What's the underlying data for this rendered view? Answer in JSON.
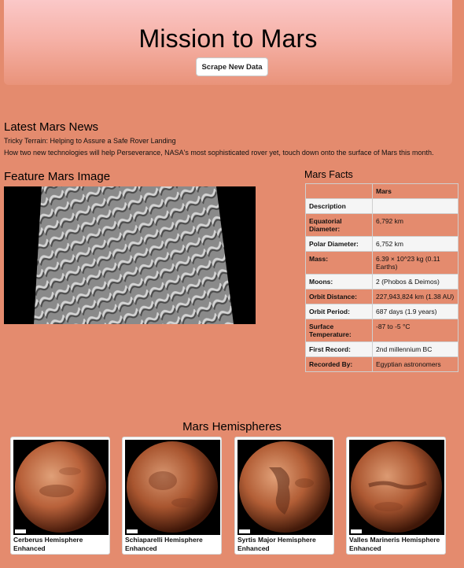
{
  "header": {
    "title": "Mission to Mars",
    "scrape_button_label": "Scrape New Data"
  },
  "news": {
    "section_title": "Latest Mars News",
    "headline": "Tricky Terrain: Helping to Assure a Safe Rover Landing",
    "teaser": "How two new technologies will help Perseverance, NASA's most sophisticated rover yet, touch down onto the surface of Mars this month."
  },
  "feature": {
    "section_title": "Feature Mars Image"
  },
  "facts": {
    "section_title": "Mars Facts",
    "header": "Mars",
    "rows": [
      {
        "label": "Description",
        "value": ""
      },
      {
        "label": "Equatorial Diameter:",
        "value": "6,792 km"
      },
      {
        "label": "Polar Diameter:",
        "value": "6,752 km"
      },
      {
        "label": "Mass:",
        "value": "6.39 × 10^23 kg (0.11 Earths)"
      },
      {
        "label": "Moons:",
        "value": "2 (Phobos & Deimos)"
      },
      {
        "label": "Orbit Distance:",
        "value": "227,943,824 km (1.38 AU)"
      },
      {
        "label": "Orbit Period:",
        "value": "687 days (1.9 years)"
      },
      {
        "label": "Surface Temperature:",
        "value": "-87 to -5 °C"
      },
      {
        "label": "First Record:",
        "value": "2nd millennium BC"
      },
      {
        "label": "Recorded By:",
        "value": "Egyptian astronomers"
      }
    ]
  },
  "hemispheres": {
    "section_title": "Mars Hemispheres",
    "items": [
      {
        "title": "Cerberus Hemisphere Enhanced"
      },
      {
        "title": "Schiaparelli Hemisphere Enhanced"
      },
      {
        "title": "Syrtis Major Hemisphere Enhanced"
      },
      {
        "title": "Valles Marineris Hemisphere Enhanced"
      }
    ]
  },
  "colors": {
    "page_background": "#e48b6e",
    "jumbotron_top": "#fbc8c8",
    "table_row_alt": "#f5f5f5"
  }
}
